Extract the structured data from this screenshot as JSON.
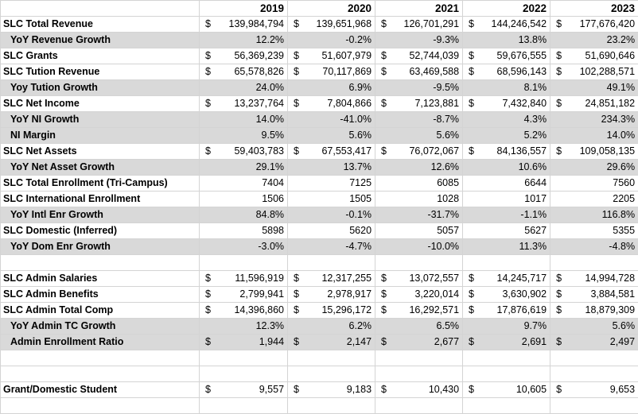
{
  "years": [
    "2019",
    "2020",
    "2021",
    "2022",
    "2023"
  ],
  "rows": [
    {
      "label": "SLC Total Revenue",
      "sub": false,
      "shade": false,
      "cur": [
        "$",
        "$",
        "$",
        "$",
        "$"
      ],
      "values": [
        "139,984,794",
        "139,651,968",
        "126,701,291",
        "144,246,542",
        "177,676,420"
      ]
    },
    {
      "label": "YoY Revenue Growth",
      "sub": true,
      "shade": true,
      "cur": [
        "",
        "",
        "",
        "",
        ""
      ],
      "values": [
        "12.2%",
        "-0.2%",
        "-9.3%",
        "13.8%",
        "23.2%"
      ]
    },
    {
      "label": "SLC Grants",
      "sub": false,
      "shade": false,
      "cur": [
        "$",
        "$",
        "$",
        "$",
        "$"
      ],
      "values": [
        "56,369,239",
        "51,607,979",
        "52,744,039",
        "59,676,555",
        "51,690,646"
      ]
    },
    {
      "label": "SLC Tution Revenue",
      "sub": false,
      "shade": false,
      "cur": [
        "$",
        "$",
        "$",
        "$",
        "$"
      ],
      "values": [
        "65,578,826",
        "70,117,869",
        "63,469,588",
        "68,596,143",
        "102,288,571"
      ]
    },
    {
      "label": "Yoy Tution Growth",
      "sub": true,
      "shade": true,
      "cur": [
        "",
        "",
        "",
        "",
        ""
      ],
      "values": [
        "24.0%",
        "6.9%",
        "-9.5%",
        "8.1%",
        "49.1%"
      ]
    },
    {
      "label": "SLC Net Income",
      "sub": false,
      "shade": false,
      "cur": [
        "$",
        "$",
        "$",
        "$",
        "$"
      ],
      "values": [
        "13,237,764",
        "7,804,866",
        "7,123,881",
        "7,432,840",
        "24,851,182"
      ]
    },
    {
      "label": "YoY NI Growth",
      "sub": true,
      "shade": true,
      "cur": [
        "",
        "",
        "",
        "",
        ""
      ],
      "values": [
        "14.0%",
        "-41.0%",
        "-8.7%",
        "4.3%",
        "234.3%"
      ]
    },
    {
      "label": "NI Margin",
      "sub": true,
      "shade": true,
      "cur": [
        "",
        "",
        "",
        "",
        ""
      ],
      "values": [
        "9.5%",
        "5.6%",
        "5.6%",
        "5.2%",
        "14.0%"
      ]
    },
    {
      "label": "SLC Net Assets",
      "sub": false,
      "shade": false,
      "cur": [
        "$",
        "$",
        "$",
        "$",
        "$"
      ],
      "values": [
        "59,403,783",
        "67,553,417",
        "76,072,067",
        "84,136,557",
        "109,058,135"
      ]
    },
    {
      "label": "YoY Net Asset Growth",
      "sub": true,
      "shade": true,
      "cur": [
        "",
        "",
        "",
        "",
        ""
      ],
      "values": [
        "29.1%",
        "13.7%",
        "12.6%",
        "10.6%",
        "29.6%"
      ]
    },
    {
      "label": "SLC Total Enrollment (Tri-Campus)",
      "sub": false,
      "shade": false,
      "cur": [
        "",
        "",
        "",
        "",
        ""
      ],
      "values": [
        "7404",
        "7125",
        "6085",
        "6644",
        "7560"
      ]
    },
    {
      "label": "SLC International Enrollment",
      "sub": false,
      "shade": false,
      "cur": [
        "",
        "",
        "",
        "",
        ""
      ],
      "values": [
        "1506",
        "1505",
        "1028",
        "1017",
        "2205"
      ]
    },
    {
      "label": "YoY Intl Enr Growth",
      "sub": true,
      "shade": true,
      "cur": [
        "",
        "",
        "",
        "",
        ""
      ],
      "values": [
        "84.8%",
        "-0.1%",
        "-31.7%",
        "-1.1%",
        "116.8%"
      ]
    },
    {
      "label": "SLC Domestic (Inferred)",
      "sub": false,
      "shade": false,
      "cur": [
        "",
        "",
        "",
        "",
        ""
      ],
      "values": [
        "5898",
        "5620",
        "5057",
        "5627",
        "5355"
      ]
    },
    {
      "label": "YoY Dom Enr Growth",
      "sub": true,
      "shade": true,
      "cur": [
        "",
        "",
        "",
        "",
        ""
      ],
      "values": [
        "-3.0%",
        "-4.7%",
        "-10.0%",
        "11.3%",
        "-4.8%"
      ]
    },
    {
      "gap": true
    },
    {
      "label": "SLC Admin Salaries",
      "sub": false,
      "shade": false,
      "cur": [
        "$",
        "$",
        "$",
        "$",
        "$"
      ],
      "values": [
        "11,596,919",
        "12,317,255",
        "13,072,557",
        "14,245,717",
        "14,994,728"
      ]
    },
    {
      "label": "SLC Admin Benefits",
      "sub": false,
      "shade": false,
      "cur": [
        "$",
        "$",
        "$",
        "$",
        "$"
      ],
      "values": [
        "2,799,941",
        "2,978,917",
        "3,220,014",
        "3,630,902",
        "3,884,581"
      ]
    },
    {
      "label": "SLC Admin Total Comp",
      "sub": false,
      "shade": false,
      "topline": true,
      "cur": [
        "$",
        "$",
        "$",
        "$",
        "$"
      ],
      "values": [
        "14,396,860",
        "15,296,172",
        "16,292,571",
        "17,876,619",
        "18,879,309"
      ]
    },
    {
      "label": "YoY Admin TC Growth",
      "sub": true,
      "shade": true,
      "cur": [
        "",
        "",
        "",
        "",
        ""
      ],
      "values": [
        "12.3%",
        "6.2%",
        "6.5%",
        "9.7%",
        "5.6%"
      ]
    },
    {
      "label": "Admin Enrollment Ratio",
      "sub": true,
      "shade": true,
      "cur": [
        "$",
        "$",
        "$",
        "$",
        "$"
      ],
      "values": [
        "1,944",
        "2,147",
        "2,677",
        "2,691",
        "2,497"
      ]
    },
    {
      "gap": true
    },
    {
      "gap": true
    },
    {
      "label": "Grant/Domestic Student",
      "sub": false,
      "shade": false,
      "cur": [
        "$",
        "$",
        "$",
        "$",
        "$"
      ],
      "values": [
        "9,557",
        "9,183",
        "10,430",
        "10,605",
        "9,653"
      ]
    },
    {
      "gap": true
    }
  ]
}
